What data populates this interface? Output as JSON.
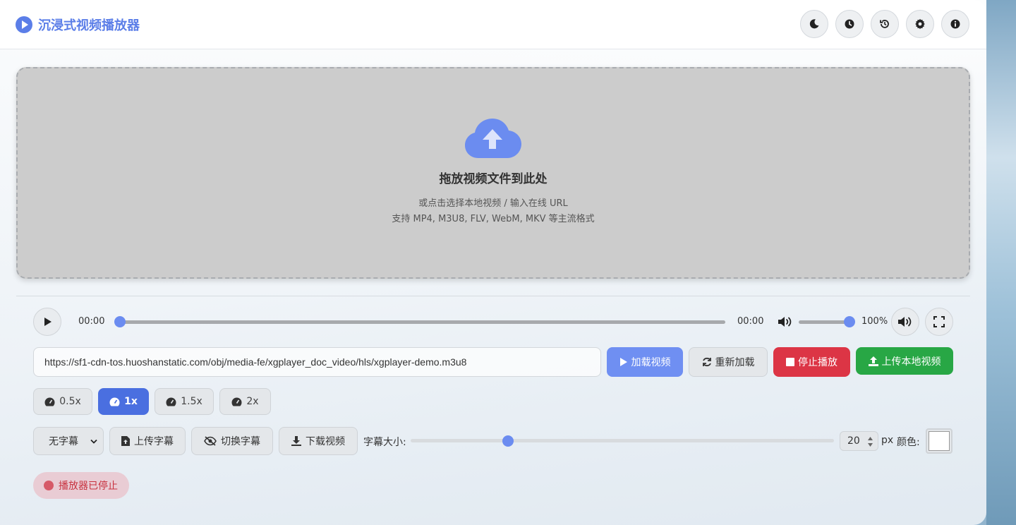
{
  "header": {
    "title": "沉浸式视频播放器",
    "buttons": [
      "moon-icon",
      "clock-icon",
      "history-icon",
      "gear-icon",
      "info-icon"
    ]
  },
  "dropzone": {
    "title": "拖放视频文件到此处",
    "line1": "或点击选择本地视频 / 输入在线 URL",
    "line2": "支持 MP4, M3U8, FLV, WebM, MKV 等主流格式"
  },
  "player": {
    "current_time": "00:00",
    "duration": "00:00",
    "progress": 0,
    "volume": 1.0,
    "volume_label": "100%"
  },
  "url": {
    "value": "https://sf1-cdn-tos.huoshanstatic.com/obj/media-fe/xgplayer_doc_video/hls/xgplayer-demo.m3u8"
  },
  "actions": {
    "load": "加载视频",
    "reload": "重新加载",
    "stop": "停止播放",
    "upload_local": "上传本地视频"
  },
  "speeds": [
    {
      "label": "0.5x",
      "active": false
    },
    {
      "label": "1x",
      "active": true
    },
    {
      "label": "1.5x",
      "active": false
    },
    {
      "label": "2x",
      "active": false
    }
  ],
  "subtitles": {
    "select_value": "无字幕",
    "upload": "上传字幕",
    "toggle": "切换字幕",
    "download": "下载视频",
    "size_label": "字幕大小:",
    "size_value": "20",
    "size_unit": "px",
    "color_label": "颜色:",
    "size_slider": 0.23,
    "color": "#ffffff"
  },
  "status": {
    "text": "播放器已停止"
  },
  "colors": {
    "accent": "#5b7ee8",
    "stop": "#dc3545",
    "upload": "#28a745"
  }
}
